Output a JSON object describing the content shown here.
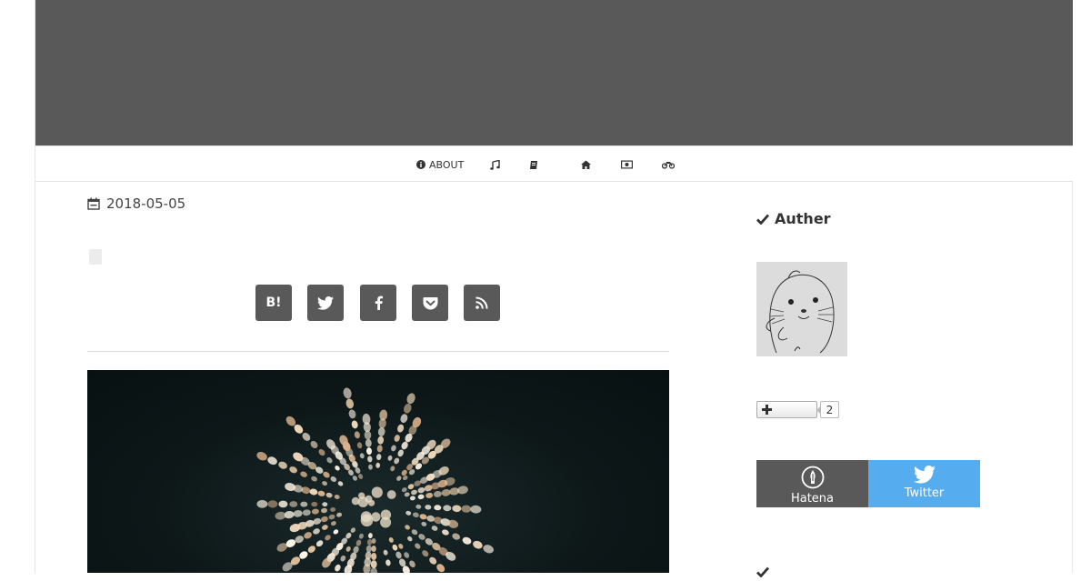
{
  "nav": {
    "about_label": "ABOUT"
  },
  "post": {
    "date": "2018-05-05"
  },
  "share": {
    "hatena_label": "B!"
  },
  "sidebar": {
    "author_title": "Auther",
    "bookmark_count": "2",
    "follow_hatena_label": "Hatena",
    "follow_twitter_label": "Twitter"
  },
  "colors": {
    "banner": "#595959",
    "button": "#595959",
    "twitter": "#55acee"
  }
}
